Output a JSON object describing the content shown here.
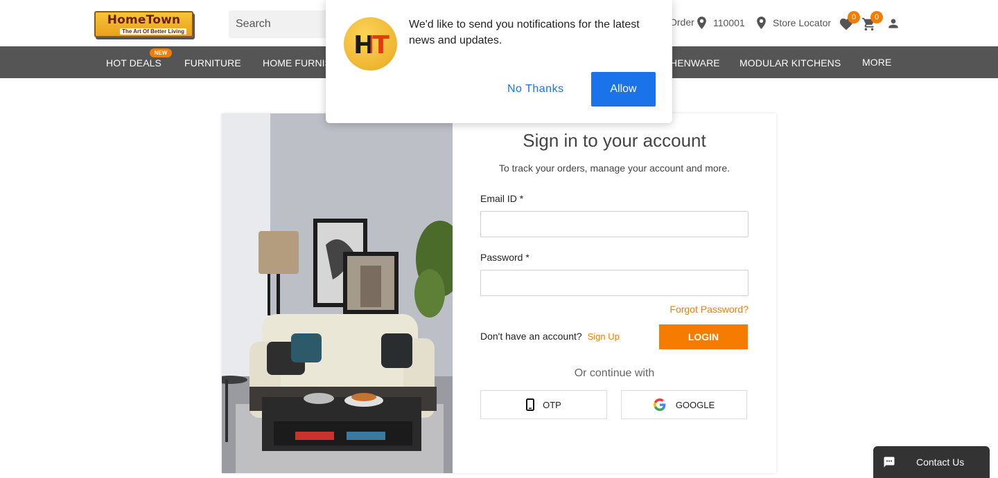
{
  "header": {
    "logo_text": "HomeTown",
    "logo_tagline": "The Art Of Better Living",
    "search_placeholder": "Search",
    "track_order": "Order",
    "pincode": "110001",
    "store_locator": "Store Locator",
    "wishlist_count": "0",
    "cart_count": "0"
  },
  "nav": {
    "items": [
      "HOT DEALS",
      "FURNITURE",
      "HOME FURNIS",
      "HENWARE",
      "MODULAR KITCHENS",
      "MORE"
    ],
    "new_badge": "NEW"
  },
  "notification": {
    "logo_text": "HT",
    "message": "We'd like to send you notifications for the latest news and updates.",
    "no_thanks": "No Thanks",
    "allow": "Allow"
  },
  "signin": {
    "title": "Sign in to your account",
    "subtitle": "To track your orders, manage your account and more.",
    "email_label": "Email ID *",
    "password_label": "Password *",
    "forgot": "Forgot Password?",
    "no_account": "Don't have an account?",
    "sign_up": "Sign Up",
    "login": "LOGIN",
    "or_continue": "Or continue with",
    "otp": "OTP",
    "google": "GOOGLE"
  },
  "contact": {
    "label": "Contact Us"
  },
  "colors": {
    "accent": "#f57c00",
    "nav_bg": "#555555",
    "allow_blue": "#1a73e8"
  }
}
